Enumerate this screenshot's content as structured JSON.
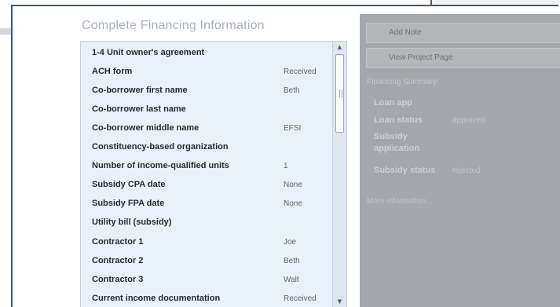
{
  "financing": {
    "title": "Complete Financing Information",
    "rows": [
      {
        "label": "1-4 Unit owner's agreement",
        "value": ""
      },
      {
        "label": "ACH form",
        "value": "Received"
      },
      {
        "label": "Co-borrower first name",
        "value": "Beth"
      },
      {
        "label": "Co-borrower last name",
        "value": ""
      },
      {
        "label": "Co-borrower middle name",
        "value": "EFSI"
      },
      {
        "label": "Constituency-based organization",
        "value": ""
      },
      {
        "label": "Number of income-qualified units",
        "value": "1"
      },
      {
        "label": "Subsidy CPA date",
        "value": "None"
      },
      {
        "label": "Subsidy FPA date",
        "value": "None"
      },
      {
        "label": "Utility bill (subsidy)",
        "value": ""
      },
      {
        "label": "Contractor 1",
        "value": "Joe"
      },
      {
        "label": "Contractor 2",
        "value": "Beth"
      },
      {
        "label": "Contractor 3",
        "value": "Walt"
      },
      {
        "label": "Current income documentation",
        "value": "Received"
      }
    ]
  },
  "side": {
    "add_note": "Add Note",
    "view_project": "View Project Page",
    "summary_title": "Financing Summary:",
    "summary": [
      {
        "label": "Loan app",
        "value": ""
      },
      {
        "label": "Loan status",
        "value": "approved"
      },
      {
        "label": "Subsidy application",
        "value": ""
      },
      {
        "label": "Subsidy status",
        "value": "rejected"
      }
    ],
    "more_link": "More information..."
  },
  "icons": {
    "scroll_up": "triangle-up",
    "scroll_down": "triangle-down"
  },
  "colors": {
    "frame_border": "#2f5b8a",
    "list_background": "#e9f2fb",
    "side_pane": "#a3a7ab"
  }
}
